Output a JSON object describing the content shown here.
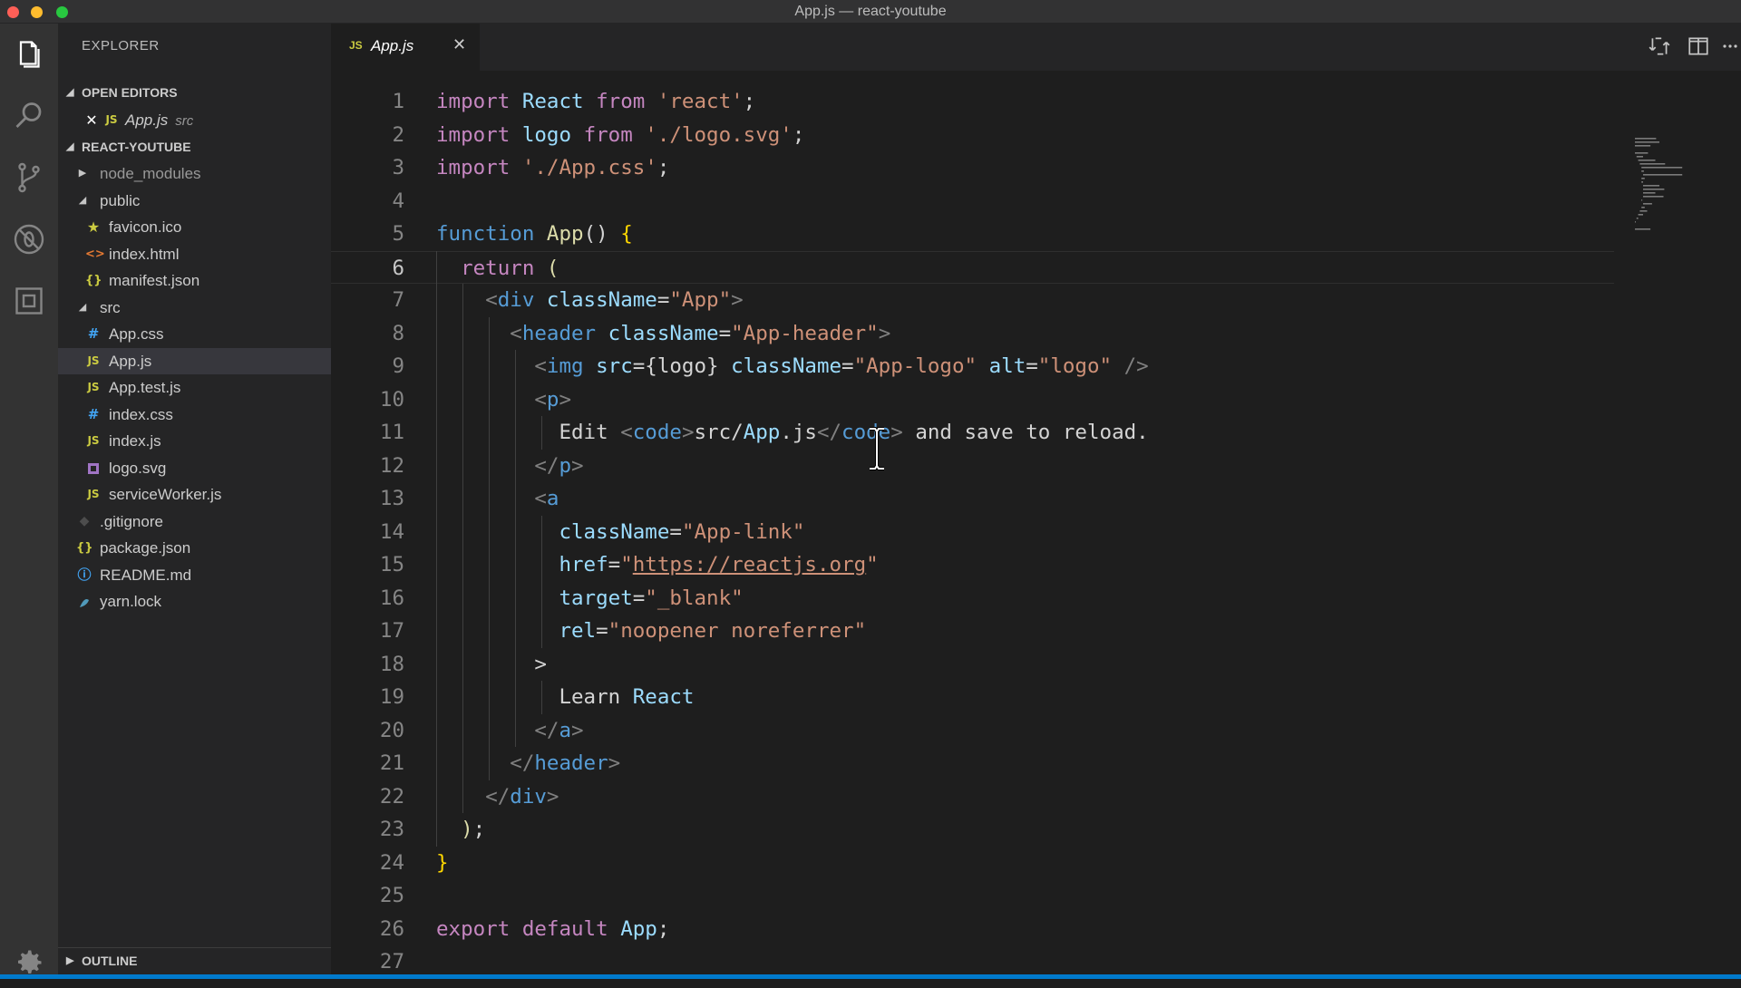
{
  "window": {
    "title": "App.js — react-youtube"
  },
  "sidebar": {
    "title": "EXPLORER",
    "open_editors": {
      "label": "OPEN EDITORS",
      "items": [
        {
          "icon": "JS",
          "name": "App.js",
          "description": "src"
        }
      ]
    },
    "project": {
      "label": "REACT-YOUTUBE",
      "items": [
        {
          "name": "node_modules",
          "kind": "folder-collapsed"
        },
        {
          "name": "public",
          "kind": "folder-expanded"
        },
        {
          "name": "favicon.ico",
          "icon": "★"
        },
        {
          "name": "index.html",
          "icon": "<>"
        },
        {
          "name": "manifest.json",
          "icon": "{}"
        },
        {
          "name": "src",
          "kind": "folder-expanded"
        },
        {
          "name": "App.css",
          "icon": "#"
        },
        {
          "name": "App.js",
          "icon": "JS"
        },
        {
          "name": "App.test.js",
          "icon": "JS"
        },
        {
          "name": "index.css",
          "icon": "#"
        },
        {
          "name": "index.js",
          "icon": "JS"
        },
        {
          "name": "logo.svg",
          "icon": "svg-file-icon"
        },
        {
          "name": "serviceWorker.js",
          "icon": "JS"
        },
        {
          "name": ".gitignore",
          "icon": "◆"
        },
        {
          "name": "package.json",
          "icon": "{}"
        },
        {
          "name": "README.md",
          "icon": "ⓘ"
        },
        {
          "name": "yarn.lock",
          "icon": "yarn-icon"
        }
      ]
    },
    "outline": {
      "label": "OUTLINE"
    }
  },
  "tabs": [
    {
      "icon": "JS",
      "label": "App.js"
    }
  ],
  "editor": {
    "current_line": 6,
    "lines": [
      {
        "n": "1",
        "text": "import React from 'react';"
      },
      {
        "n": "2",
        "text": "import logo from './logo.svg';"
      },
      {
        "n": "3",
        "text": "import './App.css';"
      },
      {
        "n": "4",
        "text": ""
      },
      {
        "n": "5",
        "text": "function App() {"
      },
      {
        "n": "6",
        "text": "  return ("
      },
      {
        "n": "7",
        "text": "    <div className=\"App\">"
      },
      {
        "n": "8",
        "text": "      <header className=\"App-header\">"
      },
      {
        "n": "9",
        "text": "        <img src={logo} className=\"App-logo\" alt=\"logo\" />"
      },
      {
        "n": "10",
        "text": "        <p>"
      },
      {
        "n": "11",
        "text": "          Edit <code>src/App.js</code> and save to reload."
      },
      {
        "n": "12",
        "text": "        </p>"
      },
      {
        "n": "13",
        "text": "        <a"
      },
      {
        "n": "14",
        "text": "          className=\"App-link\""
      },
      {
        "n": "15",
        "text": "          href=\"https://reactjs.org\""
      },
      {
        "n": "16",
        "text": "          target=\"_blank\""
      },
      {
        "n": "17",
        "text": "          rel=\"noopener noreferrer\""
      },
      {
        "n": "18",
        "text": "        >"
      },
      {
        "n": "19",
        "text": "          Learn React"
      },
      {
        "n": "20",
        "text": "        </a>"
      },
      {
        "n": "21",
        "text": "      </header>"
      },
      {
        "n": "22",
        "text": "    </div>"
      },
      {
        "n": "23",
        "text": "  );"
      },
      {
        "n": "24",
        "text": "}"
      },
      {
        "n": "25",
        "text": ""
      },
      {
        "n": "26",
        "text": "export default App;"
      },
      {
        "n": "27",
        "text": ""
      }
    ]
  },
  "colors": {
    "accent": "#007acc",
    "js_icon": "#cbcb41",
    "css_icon": "#42a5f5",
    "html_icon": "#e37933",
    "json_icon": "#cbcb41"
  }
}
